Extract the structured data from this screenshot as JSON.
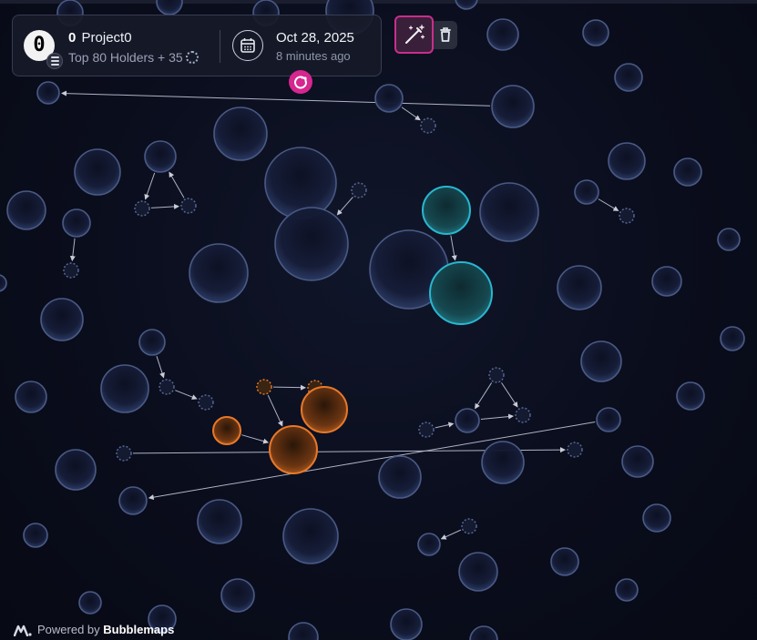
{
  "header": {
    "logo_glyph": "0",
    "token_symbol": "0",
    "token_name": "Project0",
    "holders_text": "Top 80 Holders + 35",
    "date": "Oct 28, 2025",
    "updated_ago": "8 minutes ago",
    "icons": {
      "chain": "layers-icon",
      "calendar": "calendar-icon",
      "refresh": "refresh-icon",
      "magic": "magic-wand-icon",
      "trash": "trash-icon",
      "loading": "spinner-icon"
    }
  },
  "footer": {
    "prefix": "Powered by",
    "brand": "Bubblemaps"
  },
  "colors": {
    "bubble_default": "#4a5a85",
    "cluster_cyan": "#29b6d0",
    "cluster_orange": "#e8782a",
    "accent_pink": "#d6268f"
  }
}
